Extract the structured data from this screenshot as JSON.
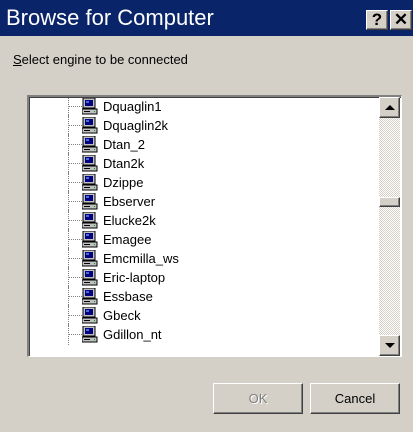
{
  "window": {
    "title": "Browse for Computer",
    "help_glyph": "?",
    "close_glyph": "✕"
  },
  "instruction": {
    "mnemonic": "S",
    "rest": "elect engine to be connected"
  },
  "tree": {
    "items": [
      "Dquaglin1",
      "Dquaglin2k",
      "Dtan_2",
      "Dtan2k",
      "Dzippe",
      "Ebserver",
      "Elucke2k",
      "Emagee",
      "Emcmilla_ws",
      "Eric-laptop",
      "Essbase",
      "Gbeck",
      "Gdillon_nt"
    ],
    "icon": "computer-icon"
  },
  "buttons": {
    "ok": "OK",
    "cancel": "Cancel"
  },
  "colors": {
    "titlebar": "#0a246a",
    "face": "#d4d0c8"
  }
}
